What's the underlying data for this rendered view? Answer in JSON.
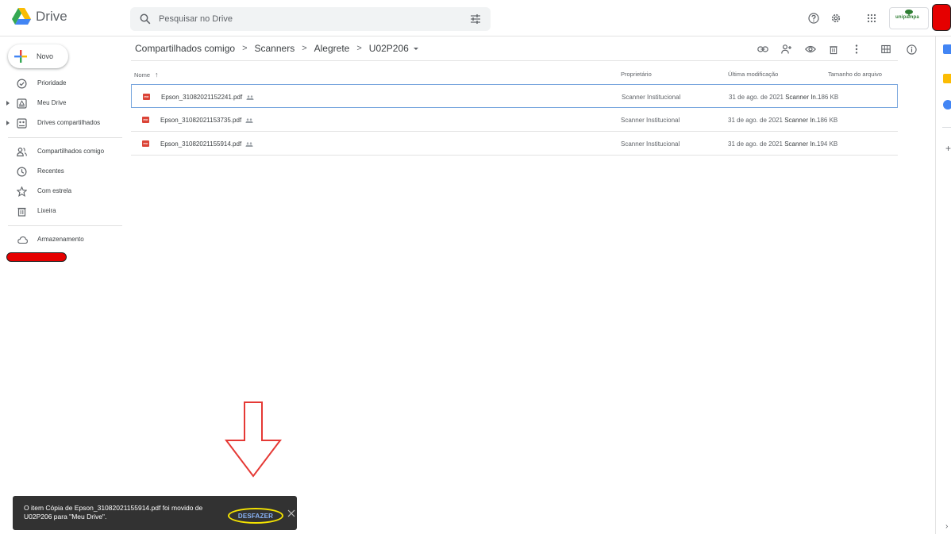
{
  "app": {
    "name": "Drive"
  },
  "search": {
    "placeholder": "Pesquisar no Drive"
  },
  "header": {
    "university_logo_text": "unipampa"
  },
  "sidebar": {
    "new_label": "Novo",
    "items": [
      {
        "label": "Prioridade",
        "icon": "priority-check-icon"
      },
      {
        "label": "Meu Drive",
        "icon": "my-drive-icon"
      },
      {
        "label": "Drives compartilhados",
        "icon": "shared-drives-icon"
      },
      {
        "label": "Compartilhados comigo",
        "icon": "shared-with-me-icon"
      },
      {
        "label": "Recentes",
        "icon": "clock-icon"
      },
      {
        "label": "Com estrela",
        "icon": "star-icon"
      },
      {
        "label": "Lixeira",
        "icon": "trash-icon"
      },
      {
        "label": "Armazenamento",
        "icon": "cloud-icon"
      }
    ]
  },
  "breadcrumb": [
    "Compartilhados comigo",
    "Scanners",
    "Alegrete",
    "U02P206"
  ],
  "breadcrumb_separator": ">",
  "columns": {
    "name": "Nome",
    "owner": "Proprietário",
    "modified": "Última modificação",
    "size": "Tamanho do arquivo"
  },
  "files": [
    {
      "name": "Epson_31082021152241.pdf",
      "badge": "PDF",
      "owner": "Scanner Institucional",
      "modified": "31 de ago. de 2021",
      "modified_by": "Scanner In...",
      "size": "186 KB",
      "selected": true
    },
    {
      "name": "Epson_31082021153735.pdf",
      "badge": "PDF",
      "owner": "Scanner Institucional",
      "modified": "31 de ago. de 2021",
      "modified_by": "Scanner In...",
      "size": "186 KB",
      "selected": false
    },
    {
      "name": "Epson_31082021155914.pdf",
      "badge": "PDF",
      "owner": "Scanner Institucional",
      "modified": "31 de ago. de 2021",
      "modified_by": "Scanner In...",
      "size": "194 KB",
      "selected": false
    }
  ],
  "snackbar": {
    "message": "O item Cópia de Epson_31082021155914.pdf foi movido de U02P206 para \"Meu Drive\".",
    "action_label": "DESFAZER"
  },
  "colors": {
    "google_blue": "#4285f4",
    "google_red": "#ea4335",
    "google_yellow": "#fbbc04",
    "google_green": "#34a853",
    "pdf_red": "#db4437",
    "snackbar_bg": "#323232",
    "annotation_red": "#e53935",
    "highlight_yellow": "#f4e300",
    "selected_border": "#7aa7de"
  }
}
